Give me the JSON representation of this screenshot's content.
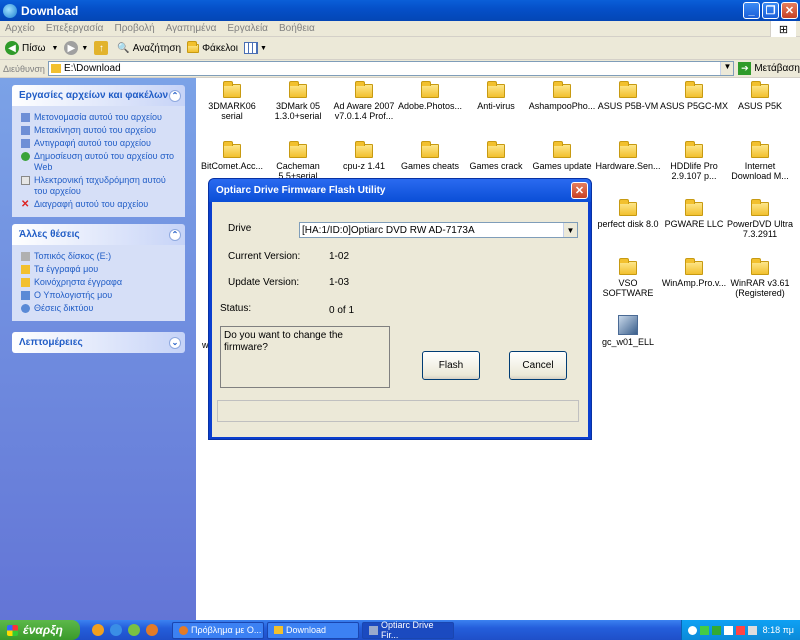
{
  "window": {
    "title": "Download"
  },
  "menubar": [
    "Αρχείο",
    "Επεξεργασία",
    "Προβολή",
    "Αγαπημένα",
    "Εργαλεία",
    "Βοήθεια"
  ],
  "toolbar": {
    "back": "Πίσω",
    "search": "Αναζήτηση",
    "folders": "Φάκελοι"
  },
  "address": {
    "label": "Διεύθυνση",
    "value": "E:\\Download",
    "go": "Μετάβαση"
  },
  "sidebar": {
    "tasks": {
      "title": "Εργασίες αρχείων και φακέλων",
      "items": [
        {
          "label": "Μετονομασία αυτού του αρχείου",
          "icon": "rename-icon"
        },
        {
          "label": "Μετακίνηση αυτού του αρχείου",
          "icon": "move-icon"
        },
        {
          "label": "Αντιγραφή αυτού του αρχείου",
          "icon": "copy-icon"
        },
        {
          "label": "Δημοσίευση αυτού του αρχείου στο Web",
          "icon": "publish-web-icon"
        },
        {
          "label": "Ηλεκτρονική ταχυδρόμηση αυτού του αρχείου",
          "icon": "email-icon"
        },
        {
          "label": "Διαγραφή αυτού του αρχείου",
          "icon": "delete-icon"
        }
      ]
    },
    "places": {
      "title": "Άλλες θέσεις",
      "items": [
        {
          "label": "Τοπικός δίσκος (E:)",
          "icon": "drive-icon"
        },
        {
          "label": "Τα έγγραφά μου",
          "icon": "folder-icon"
        },
        {
          "label": "Κοινόχρηστα έγγραφα",
          "icon": "folder-icon"
        },
        {
          "label": "Ο Υπολογιστής μου",
          "icon": "computer-icon"
        },
        {
          "label": "Θέσεις δικτύου",
          "icon": "network-icon"
        }
      ]
    },
    "details": {
      "title": "Λεπτομέρειες"
    }
  },
  "files": {
    "row1": [
      "3DMARK06 serial",
      "3DMark 05 1.3.0+serial",
      "Ad Aware 2007 v7.0.1.4 Prof...",
      "Adobe.Photos...",
      "Anti-virus",
      "AshampooPho...",
      "ASUS P5B-VM",
      "ASUS P5GC-MX",
      "ASUS P5K"
    ],
    "row2": [
      "BitComet.Acc...",
      "Cacheman 5.5+serial",
      "cpu-z 1.41",
      "Games cheats",
      "Games crack",
      "Games update",
      "Hardware.Sen...",
      "HDDlife Pro 2.9.107 p...",
      "Internet Download M..."
    ],
    "row3": [
      "perfect disk 8.0",
      "PGWARE LLC",
      "PowerDVD Ultra 7.3.2911"
    ],
    "row4": [
      "VSO SOFTWARE",
      "WinAmp.Pro.v...",
      "WinRAR v3.61 (Registered)"
    ],
    "row5": [
      "gc_w01_ELL"
    ],
    "partial_w": "w"
  },
  "dialog": {
    "title": "Optiarc Drive Firmware Flash Utility",
    "drive_label": "Drive",
    "drive_value": "[HA:1/ID:0]Optiarc DVD RW AD-7173A",
    "current_label": "Current Version:",
    "current_value": "1-02",
    "update_label": "Update Version:",
    "update_value": "1-03",
    "status_label": "Status:",
    "status_value": "0 of 1",
    "message": "Do you want to change the firmware?",
    "flash": "Flash",
    "cancel": "Cancel"
  },
  "taskbar": {
    "start": "έναρξη",
    "tasks": [
      "Πρόβλημα με Ο...",
      "Download",
      "Optiarc Drive Fir..."
    ],
    "clock": "8:18 πμ"
  }
}
